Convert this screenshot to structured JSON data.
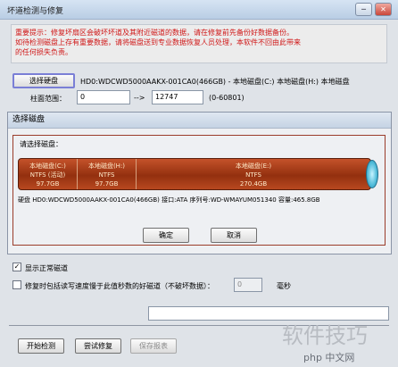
{
  "window": {
    "title": "坏道检测与修复",
    "minimize": "─",
    "close": "✕"
  },
  "warning": {
    "line1": "重要提示：修复坏扇区会破坏坏道及其附近磁道的数据，请在修复前先备份好数据备份。",
    "line2": "如待检测磁盘上存有重要数据，请将磁盘送到专业数据恢复人员处理，本软件不回由此带来",
    "line3": "的任何损失负责。"
  },
  "disk_select": {
    "button": "选择硬盘",
    "value": "HD0:WDCWD5000AAKX-001CA0(466GB) - 本地磁盘(C:) 本地磁盘(H:) 本地磁盘"
  },
  "cylinder_range": {
    "label": "柱面范围：",
    "from": "0",
    "arrow": "-->",
    "to": "12747",
    "range": "(0-60801)"
  },
  "dialog": {
    "title": "选择磁盘",
    "panel_label": "请选择磁盘：",
    "partitions": [
      {
        "name": "本地磁盘(C:)",
        "fs": "NTFS (活动)",
        "size": "97.7GB"
      },
      {
        "name": "本地磁盘(H:)",
        "fs": "NTFS",
        "size": "97.7GB"
      },
      {
        "name": "本地磁盘(E:)",
        "fs": "NTFS",
        "size": "270.4GB"
      }
    ],
    "info": "硬盘 HD0:WDCWD5000AAKX-001CA0(466GB)   接口:ATA   序列号:WD-WMAYUM051340   容量:465.8GB",
    "ok": "确定",
    "cancel": "取消"
  },
  "options": {
    "show_normal": "显示正常磁道",
    "show_normal_checked": true,
    "repair_label": "修复时包括读写速度慢于此值秒数的好磁道（不破坏数据）：",
    "repair_value": "0",
    "repair_unit": "毫秒",
    "repair_checked": false
  },
  "bottom": {
    "start": "开始检测",
    "try_repair": "尝试修复",
    "save_report": "保存报表"
  },
  "watermark": {
    "text": "软件技巧",
    "site": "php 中文网"
  }
}
